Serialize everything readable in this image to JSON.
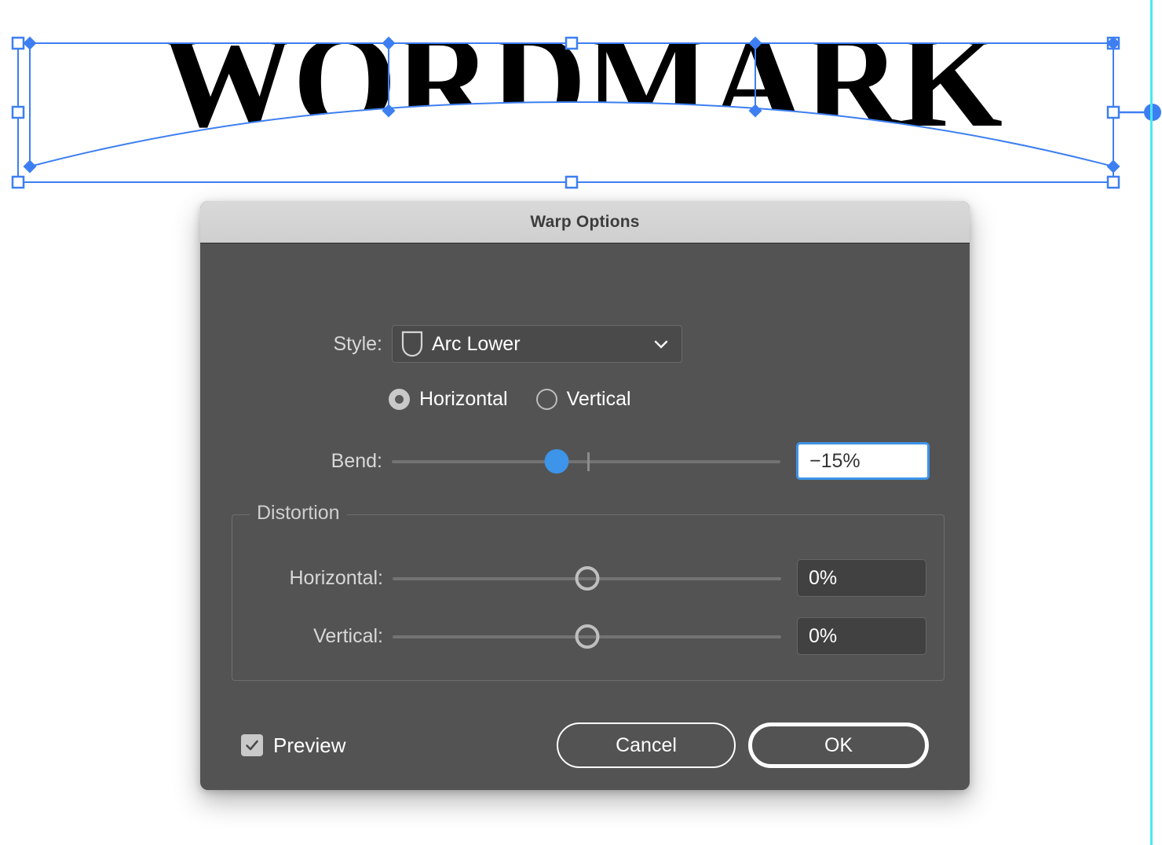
{
  "canvas": {
    "wordmark_text": "WORDMARK",
    "artboard_guide_color": "#4ae8ef",
    "selection_color": "#3d7ff2",
    "envelope_note": "Arc Lower warp envelope with mesh anchors"
  },
  "dialog": {
    "title": "Warp Options",
    "titlebar_color": "#d4d4d4",
    "body_color": "#535353",
    "style": {
      "label": "Style:",
      "value": "Arc Lower",
      "icon": "arc-lower-shield-icon",
      "caret": "chevron-down-icon"
    },
    "orientation": {
      "horizontal_label": "Horizontal",
      "vertical_label": "Vertical",
      "selected": "Horizontal"
    },
    "bend": {
      "label": "Bend:",
      "value": "−15%",
      "slider_percent": 42.5,
      "accent_color": "#3d94e8",
      "focused": true
    },
    "distortion": {
      "legend": "Distortion",
      "horizontal": {
        "label": "Horizontal:",
        "value": "0%",
        "slider_percent": 50
      },
      "vertical": {
        "label": "Vertical:",
        "value": "0%",
        "slider_percent": 50
      }
    },
    "footer": {
      "preview_label": "Preview",
      "preview_checked": true,
      "cancel_label": "Cancel",
      "ok_label": "OK"
    }
  }
}
